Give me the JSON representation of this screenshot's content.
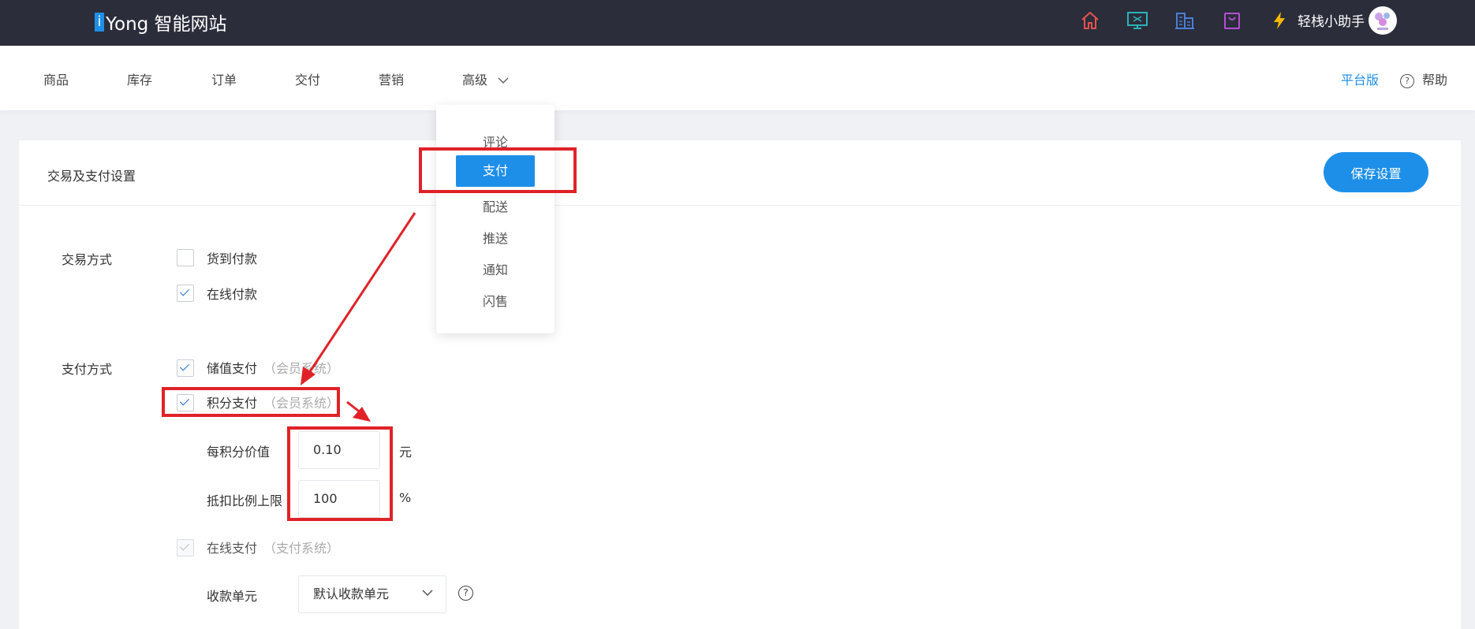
{
  "topbar": {
    "logo_letter": "i",
    "logo_text": "Yong 智能网站",
    "icons": [
      "home-icon",
      "monitor-icon",
      "buildings-icon",
      "bag-icon",
      "lightning-icon"
    ],
    "user_name": "轻栈小助手",
    "colors": {
      "background": "#2b2d3b",
      "accent": "#1e8fe8"
    }
  },
  "subnav": {
    "items": [
      "商品",
      "库存",
      "订单",
      "交付",
      "营销",
      "高级"
    ],
    "platform_link": "平台版",
    "help_link": "帮助",
    "help_icon_glyph": "?"
  },
  "dropdown": {
    "items": [
      "评论",
      "支付",
      "配送",
      "推送",
      "通知",
      "闪售"
    ],
    "active": "支付"
  },
  "card": {
    "title": "交易及支付设置",
    "save_button": "保存设置"
  },
  "trade_method": {
    "label": "交易方式",
    "options": [
      {
        "label": "货到付款",
        "checked": false
      },
      {
        "label": "在线付款",
        "checked": true
      }
    ]
  },
  "payment_method": {
    "label": "支付方式",
    "options": [
      {
        "label": "储值支付",
        "sub": "（会员系统）",
        "checked": true
      },
      {
        "label": "积分支付",
        "sub": "（会员系统）",
        "checked": true
      },
      {
        "label": "在线支付",
        "sub": "（支付系统）",
        "checked": true,
        "disabled": true
      }
    ],
    "points_value": {
      "label": "每积分价值",
      "value": "0.10",
      "unit": "元"
    },
    "deduct_limit": {
      "label": "抵扣比例上限",
      "value": "100",
      "unit": "%"
    },
    "collection_unit": {
      "label": "收款单元",
      "value": "默认收款单元",
      "help_glyph": "?"
    }
  },
  "annotation_color": "#e02228"
}
